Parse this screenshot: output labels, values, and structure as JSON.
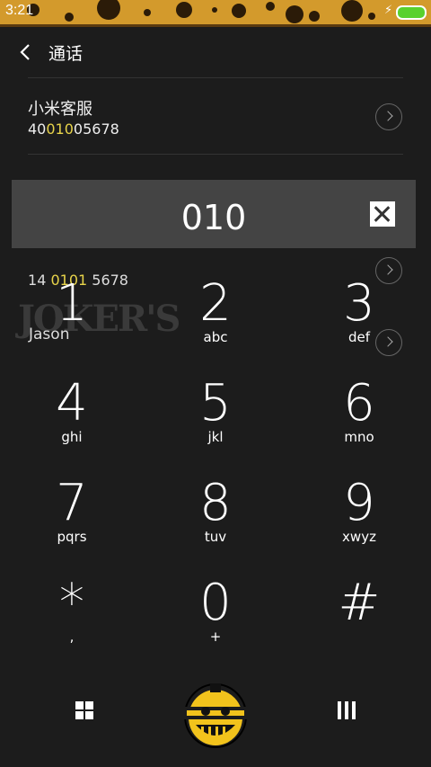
{
  "status_bar": {
    "time": "3:21"
  },
  "header": {
    "title": "通话"
  },
  "contacts": [
    {
      "name": "小米客服",
      "number_prefix": "40",
      "number_match": "010",
      "number_suffix": "05678"
    },
    {
      "name": "",
      "number_prefix": "1",
      "number_prefix2": "4 ",
      "number_match": "0101",
      "number_suffix": " 5678"
    },
    {
      "name": "Jason"
    }
  ],
  "watermark": "JOKER'S",
  "dialer": {
    "input": "010"
  },
  "keypad": [
    {
      "digit": "1",
      "letters": ""
    },
    {
      "digit": "2",
      "letters": "abc"
    },
    {
      "digit": "3",
      "letters": "def"
    },
    {
      "digit": "4",
      "letters": "ghi"
    },
    {
      "digit": "5",
      "letters": "jkl"
    },
    {
      "digit": "6",
      "letters": "mno"
    },
    {
      "digit": "7",
      "letters": "pqrs"
    },
    {
      "digit": "8",
      "letters": "tuv"
    },
    {
      "digit": "9",
      "letters": "xwyz"
    },
    {
      "digit": "*",
      "letters": ","
    },
    {
      "digit": "0",
      "letters": "+"
    },
    {
      "digit": "#",
      "letters": ""
    }
  ],
  "colors": {
    "highlight": "#e8d44a",
    "accent": "#d39a2c",
    "background": "#1c1c1c",
    "battery": "#59d12d"
  }
}
